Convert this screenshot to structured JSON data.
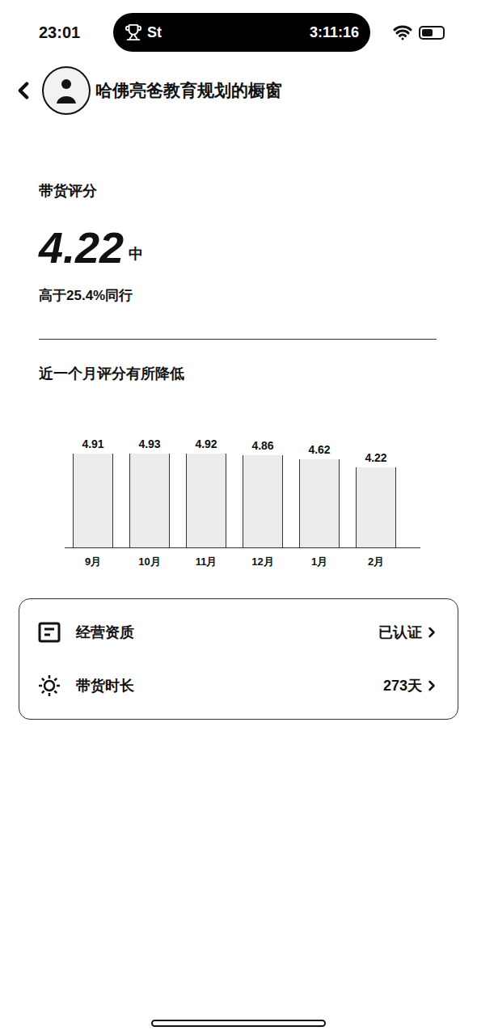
{
  "status_bar": {
    "time": "23:01",
    "island_label": "St",
    "island_timer": "3:11:16"
  },
  "header": {
    "title": "哈佛亮爸教育规划的橱窗"
  },
  "score": {
    "label": "带货评分",
    "value": "4.22",
    "grade": "中",
    "compare": "高于25.4%同行"
  },
  "chart": {
    "title": "近一个月评分有所降低",
    "series": [
      {
        "name": "评分",
        "values": [
          4.91,
          4.93,
          4.92,
          4.86,
          4.62,
          4.22
        ]
      }
    ],
    "value_labels": [
      "4.91",
      "4.93",
      "4.92",
      "4.86",
      "4.62",
      "4.22"
    ],
    "months": [
      "9月",
      "10月",
      "11月",
      "12月",
      "1月",
      "2月"
    ]
  },
  "info_rows": [
    {
      "label": "经营资质",
      "value": "已认证",
      "kind": "license"
    },
    {
      "label": "带货时长",
      "value": "273天",
      "kind": "duration"
    }
  ]
}
